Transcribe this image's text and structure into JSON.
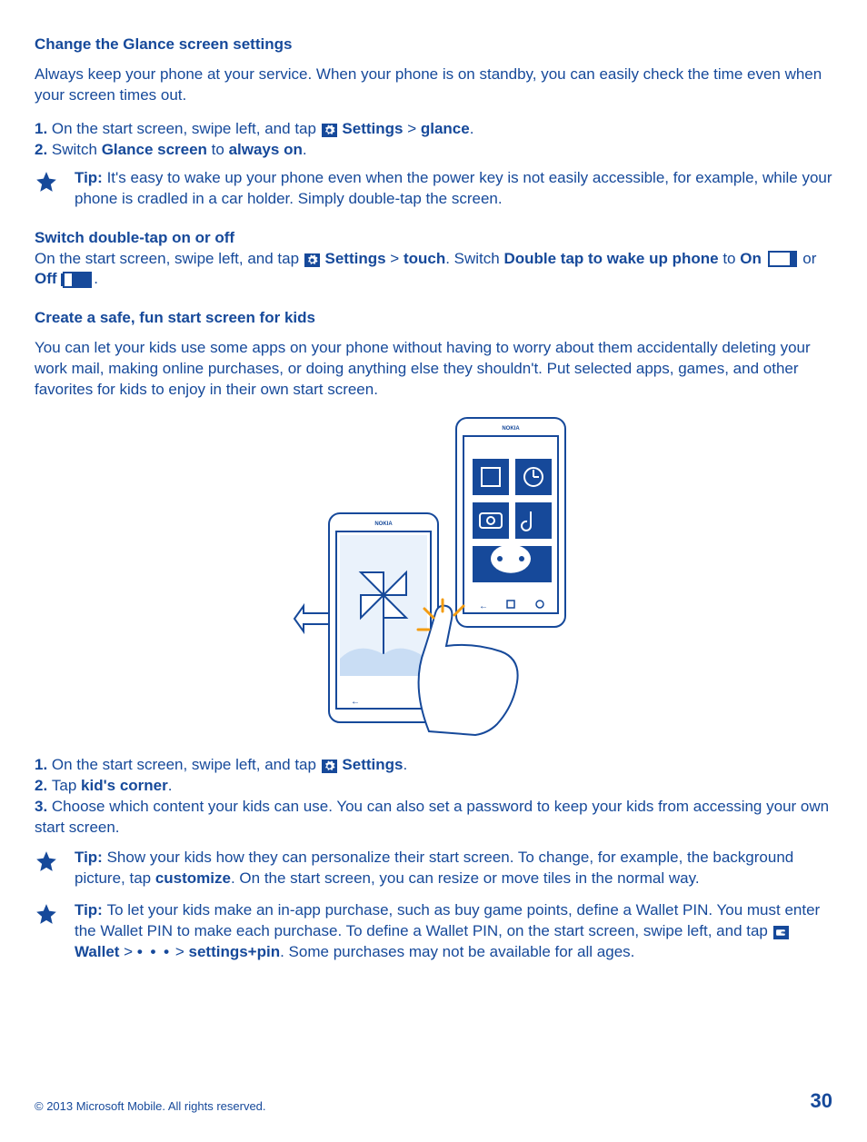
{
  "section1": {
    "heading": "Change the Glance screen settings",
    "intro": "Always keep your phone at your service. When your phone is on standby, you can easily check the time even when your screen times out.",
    "step1_num": "1. ",
    "step1_a": "On the start screen, swipe left, and tap ",
    "step1_settings": "Settings",
    "step1_arrow": " > ",
    "step1_glance": "glance",
    "step1_end": ".",
    "step2_num": "2. ",
    "step2_a": "Switch ",
    "step2_glance_screen": "Glance screen",
    "step2_to": " to ",
    "step2_always_on": "always on",
    "step2_end": ".",
    "tip_label": "Tip: ",
    "tip_text": "It's easy to wake up your phone even when the power key is not easily accessible, for example, while your phone is cradled in a car holder. Simply double-tap the screen."
  },
  "section2": {
    "heading": "Switch double-tap on or off",
    "a": "On the start screen, swipe left, and tap ",
    "settings": "Settings",
    "arrow1": " > ",
    "touch": "touch",
    "b": ". Switch ",
    "dtap": "Double tap to wake up phone",
    "to": " to ",
    "on": "On",
    "or": " or ",
    "off": "Off",
    "end": "."
  },
  "section3": {
    "heading": "Create a safe, fun start screen for kids",
    "intro": "You can let your kids use some apps on your phone without having to worry about them accidentally deleting your work mail, making online purchases, or doing anything else they shouldn't. Put selected apps, games, and other favorites for kids to enjoy in their own start screen.",
    "step1_num": "1. ",
    "step1_a": "On the start screen, swipe left, and tap ",
    "step1_settings": "Settings",
    "step1_end": ".",
    "step2_num": "2. ",
    "step2_a": "Tap ",
    "step2_kc": "kid's corner",
    "step2_end": ".",
    "step3_num": "3. ",
    "step3_text": "Choose which content your kids can use. You can also set a password to keep your kids from accessing your own start screen.",
    "tip1_label": "Tip: ",
    "tip1_a": "Show your kids how they can personalize their start screen. To change, for example, the background picture, tap ",
    "tip1_customize": "customize",
    "tip1_b": ". On the start screen, you can resize or move tiles in the normal way.",
    "tip2_label": "Tip: ",
    "tip2_a": "To let your kids make an in-app purchase, such as buy game points, define a Wallet PIN. You must enter the Wallet PIN to make each purchase. To define a Wallet PIN, on the start screen, swipe left, and tap ",
    "tip2_wallet": "Wallet",
    "tip2_arrow1": " > ",
    "tip2_dots": "• • •",
    "tip2_arrow2": " > ",
    "tip2_sp": "settings+pin",
    "tip2_b": ". Some purchases may not be available for all ages."
  },
  "footer": {
    "copyright": "© 2013 Microsoft Mobile. All rights reserved.",
    "page": "30"
  }
}
